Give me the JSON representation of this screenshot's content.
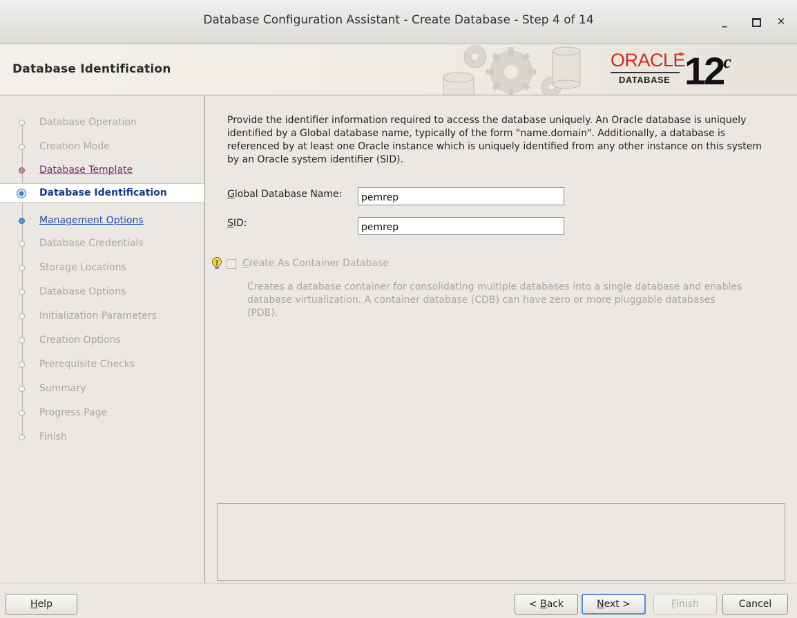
{
  "window": {
    "title": "Database Configuration Assistant - Create Database - Step 4 of 14",
    "minimize_symbol": "_",
    "maximize_symbol": "□",
    "close_symbol": "✕"
  },
  "header": {
    "page_title": "Database Identification",
    "brand_oracle": "ORACLE",
    "brand_reg": "®",
    "brand_database": "DATABASE",
    "version_number": "12",
    "version_suffix": "c"
  },
  "steps": [
    {
      "label": "Database Operation",
      "state": "disabled"
    },
    {
      "label": "Creation Mode",
      "state": "disabled"
    },
    {
      "label": "Database Template",
      "state": "visited"
    },
    {
      "label": "Database Identification",
      "state": "current"
    },
    {
      "label": "Management Options",
      "state": "next"
    },
    {
      "label": "Database Credentials",
      "state": "disabled"
    },
    {
      "label": "Storage Locations",
      "state": "disabled"
    },
    {
      "label": "Database Options",
      "state": "disabled"
    },
    {
      "label": "Initialization Parameters",
      "state": "disabled"
    },
    {
      "label": "Creation Options",
      "state": "disabled"
    },
    {
      "label": "Prerequisite Checks",
      "state": "disabled"
    },
    {
      "label": "Summary",
      "state": "disabled"
    },
    {
      "label": "Progress Page",
      "state": "disabled"
    },
    {
      "label": "Finish",
      "state": "disabled"
    }
  ],
  "main": {
    "description": "Provide the identifier information required to access the database uniquely. An Oracle database is uniquely identified by a Global database name, typically of the form \"name.domain\". Additionally, a database is referenced by at least one Oracle instance which is uniquely identified from any other instance on this system by an Oracle system identifier (SID).",
    "global_db_name": {
      "mnemonic": "G",
      "label_rest": "lobal Database Name:",
      "value": "pemrep"
    },
    "sid": {
      "mnemonic": "S",
      "label_rest": "ID:",
      "value": "pemrep"
    },
    "container": {
      "mnemonic": "C",
      "label_rest": "reate As Container Database",
      "checked": false,
      "enabled": false,
      "description": "Creates a database container for consolidating multiple databases into a single database and enables database virtualization. A container database (CDB) can have zero or more pluggable databases (PDB)."
    }
  },
  "buttons": {
    "help": {
      "mnemonic": "H",
      "rest": "elp"
    },
    "back": {
      "prefix": "< ",
      "mnemonic": "B",
      "rest": "ack"
    },
    "next": {
      "mnemonic": "N",
      "rest": "ext >"
    },
    "finish": {
      "mnemonic": "F",
      "rest": "inish",
      "enabled": false
    },
    "cancel": {
      "label": "Cancel"
    }
  },
  "colors": {
    "oracle_red": "#d22b1f",
    "current_step": "#123c85",
    "visited_step": "#7d2a73",
    "next_step": "#1d4fa5",
    "disabled_text": "#aaa69f"
  }
}
